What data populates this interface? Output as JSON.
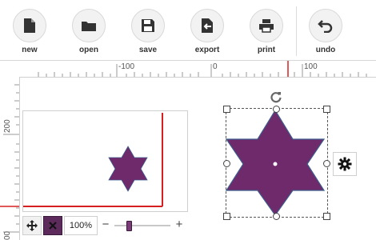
{
  "toolbar": {
    "buttons": [
      {
        "label": "new",
        "icon": "new-file-icon"
      },
      {
        "label": "open",
        "icon": "folder-icon"
      },
      {
        "label": "save",
        "icon": "floppy-disk-icon"
      },
      {
        "label": "export",
        "icon": "export-icon"
      },
      {
        "label": "print",
        "icon": "printer-icon"
      },
      {
        "label": "undo",
        "icon": "undo-icon"
      }
    ]
  },
  "rulers": {
    "horizontal_labels": [
      "-100",
      "0",
      "100"
    ],
    "vertical_labels": [
      "200",
      "00"
    ]
  },
  "navigator": {
    "zoom": "100%",
    "minus": "−",
    "plus": "+"
  },
  "shape": {
    "type": "six-pointed star",
    "fill_color": "#6e2a6b",
    "stroke_color": "#3d5a8a"
  },
  "colors": {
    "accent": "#d62020",
    "shape_fill": "#6e2a6b"
  }
}
